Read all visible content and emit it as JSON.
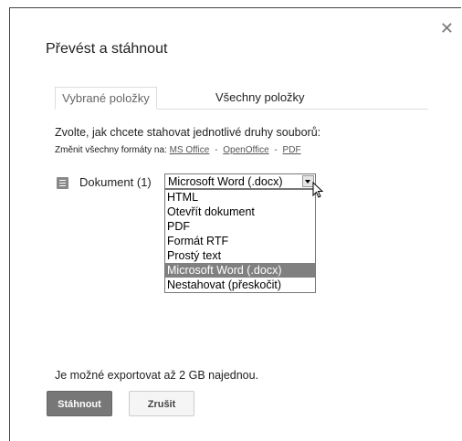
{
  "dialog": {
    "title": "Převést a stáhnout",
    "close_icon": "close-icon"
  },
  "tabs": [
    {
      "label": "Vybrané položky",
      "active": true
    },
    {
      "label": "Všechny položky",
      "active": false
    }
  ],
  "instructions": "Zvolte, jak chcete stahovat jednotlivé druhy souborů:",
  "change_all": {
    "label": "Změnit všechny formáty na:",
    "links": [
      "MS Office",
      "OpenOffice",
      "PDF"
    ],
    "separator": "-"
  },
  "document_row": {
    "icon": "document-icon",
    "label": "Dokument (1)",
    "selected_value": "Microsoft Word (.docx)",
    "options": [
      "HTML",
      "Otevřít dokument",
      "PDF",
      "Formát RTF",
      "Prostý text",
      "Microsoft Word (.docx)",
      "Nestahovat (přeskočit)"
    ],
    "highlighted_option": "Microsoft Word (.docx)"
  },
  "note": "Je možné exportovat až 2 GB najednou.",
  "buttons": {
    "download": "Stáhnout",
    "cancel": "Zrušit"
  }
}
